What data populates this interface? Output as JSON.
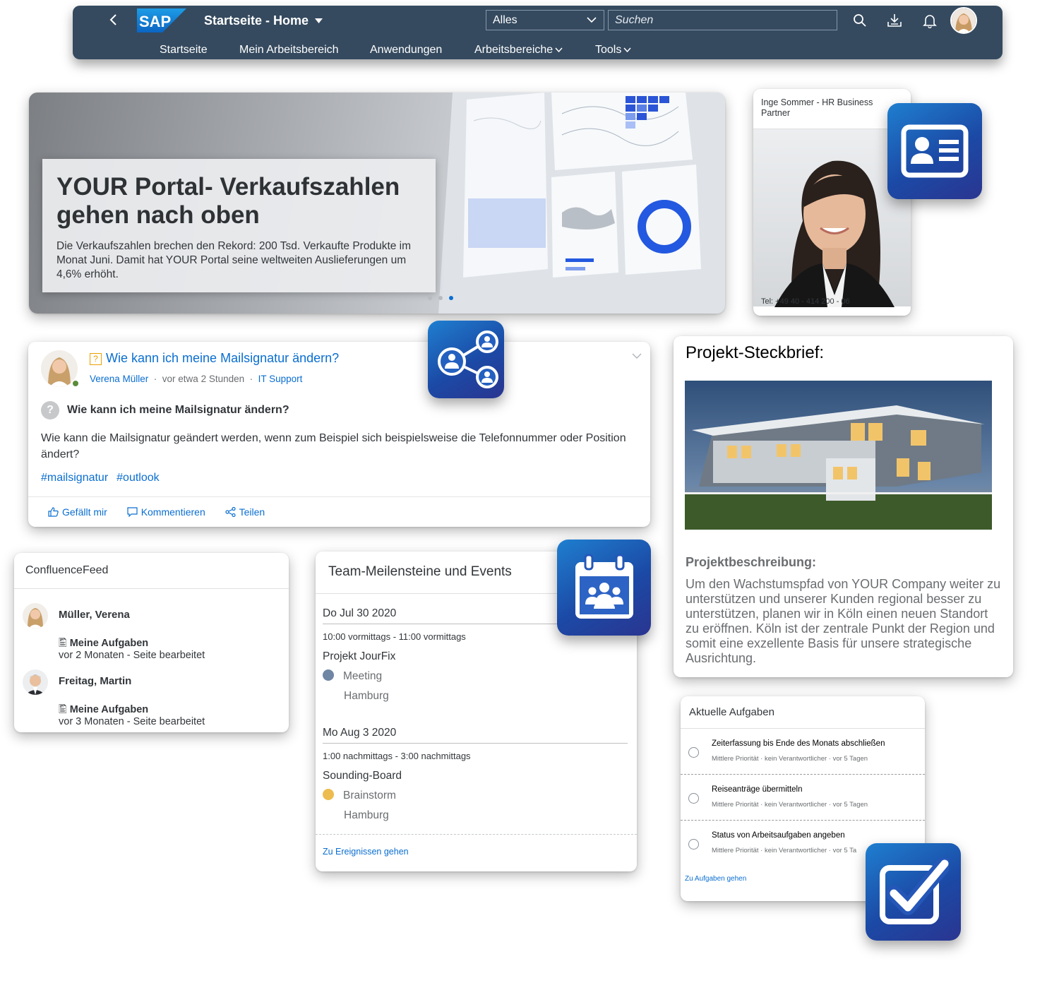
{
  "shell": {
    "title": "Startseite - Home",
    "scope_value": "Alles",
    "search_placeholder": "Suchen",
    "nav": [
      "Startseite",
      "Mein Arbeitsbereich",
      "Anwendungen",
      "Arbeitsbereiche",
      "Tools"
    ],
    "brand_color": "#354a5f",
    "logo_text": "SAP"
  },
  "hero": {
    "title": "YOUR Portal- Verkaufszahlen gehen nach oben",
    "text": "Die Verkaufszahlen brechen den Rekord: 200 Tsd. Verkaufte Produkte im Monat Juni. Damit hat YOUR Portal seine weltweiten Auslieferungen um 4,6% erhöht.",
    "slides": 3,
    "active_slide": 3
  },
  "contact": {
    "name": "Inge Sommer - HR Business Partner",
    "tel": "Tel: +49 40 - 414 200 - 06"
  },
  "question": {
    "title": "Wie kann ich meine Mailsignatur ändern?",
    "author": "Verena Müller",
    "time": "vor etwa 2 Stunden",
    "group": "IT Support",
    "heading": "Wie kann ich meine Mailsignatur ändern?",
    "body": "Wie kann die Mailsignatur geändert werden, wenn zum Beispiel sich beispielsweise die Telefonnummer oder Position ändert?",
    "tags": [
      "#mailsignatur",
      "#outlook"
    ],
    "actions": {
      "like": "Gefällt mir",
      "comment": "Kommentieren",
      "share": "Teilen"
    }
  },
  "project": {
    "title": "Projekt-Steckbrief:",
    "subtitle": "Projektbeschreibung:",
    "description": "Um den Wachstumspfad von YOUR Company weiter zu unterstützen und unserer Kunden regional besser zu unterstützen, planen wir in Köln einen neuen Standort zu eröffnen. Köln ist der zentrale Punkt der Region und somit eine exzellente Basis für unsere strategische Ausrichtung."
  },
  "confluence": {
    "title": "ConfluenceFeed",
    "entries": [
      {
        "name": "Müller, Verena",
        "page": "Meine Aufgaben",
        "when": "vor 2 Monaten",
        "action": "Seite bearbeitet"
      },
      {
        "name": "Freitag, Martin",
        "page": "Meine Aufgaben",
        "when": "vor 3 Monaten",
        "action": "Seite bearbeitet"
      }
    ]
  },
  "events": {
    "title": "Team-Meilensteine und Events",
    "days": [
      {
        "date": "Do Jul 30 2020",
        "time": "10:00 vormittags - 11:00 vormittags",
        "name": "Projekt JourFix",
        "type": "Meeting",
        "type_color": "#6f86a4",
        "location": "Hamburg"
      },
      {
        "date": "Mo Aug 3 2020",
        "time": "1:00 nachmittags - 3:00 nachmittags",
        "name": "Sounding-Board",
        "type": "Brainstorm",
        "type_color": "#edbc4f",
        "location": "Hamburg"
      }
    ],
    "footer": "Zu Ereignissen gehen"
  },
  "tasks": {
    "title": "Aktuelle Aufgaben",
    "items": [
      {
        "name": "Zeiterfassung bis Ende des Monats abschließen",
        "meta": "Mittlere Priorität · kein Verantwortlicher · vor 5 Tagen"
      },
      {
        "name": "Reiseanträge übermitteln",
        "meta": "Mittlere Priorität · kein Verantwortlicher · vor 5 Tagen"
      },
      {
        "name": "Status von Arbeitsaufgaben angeben",
        "meta": "Mittlere Priorität · kein Verantwortlicher · vor 5 Ta"
      }
    ],
    "footer": "Zu Aufgaben gehen"
  }
}
